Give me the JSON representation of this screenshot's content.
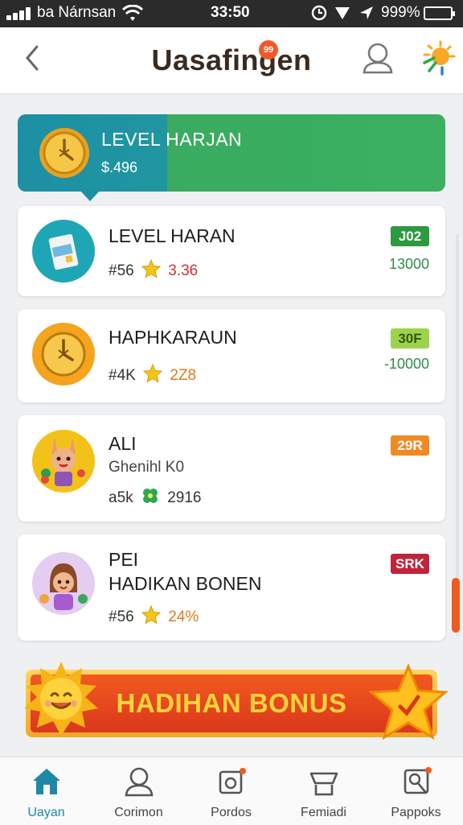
{
  "status_bar": {
    "carrier": "ba Nárnsan",
    "time": "33:50",
    "battery": "999%",
    "icons": [
      "signal-icon",
      "wifi-icon",
      "alarm-icon",
      "location-icon",
      "battery-icon"
    ]
  },
  "header": {
    "title": "Uasafingen",
    "notification_badge": "99",
    "icons": [
      "back-icon",
      "profile-icon",
      "sun-icon"
    ]
  },
  "level_banner": {
    "title": "LEVEL HARJAN",
    "subtitle": "$.496"
  },
  "cards": [
    {
      "name": "LEVEL HARAN",
      "count": "#56",
      "score": "3.36",
      "badge": "J02",
      "reward": "13000",
      "icon": "milk-carton-icon"
    },
    {
      "name": "HAPHKARAUN",
      "count": "#4K",
      "score": "2Z8",
      "badge": "30F",
      "reward": "-10000",
      "icon": "clock-coin-icon"
    },
    {
      "name": "ALI",
      "line2": "Ghenihl K0",
      "count": "a5k",
      "score": "2916",
      "badge": "29R",
      "icon": "rabbit-character-icon"
    },
    {
      "name": "PEI",
      "line2": "HADIKAN BONEN",
      "count": "#56",
      "score": "24%",
      "badge": "SRK",
      "icon": "girl-character-icon"
    }
  ],
  "bonus": {
    "label": "HADIHAN BONUS"
  },
  "bottom_nav": [
    {
      "label": "Uayan",
      "icon": "home-icon",
      "active": true
    },
    {
      "label": "Corimon",
      "icon": "profile-icon",
      "active": false
    },
    {
      "label": "Pordos",
      "icon": "card-icon",
      "active": false
    },
    {
      "label": "Femiadi",
      "icon": "basket-icon",
      "active": false
    },
    {
      "label": "Pappoks",
      "icon": "avatar-icon",
      "active": false
    }
  ],
  "colors": {
    "accent_teal": "#1d8fa5",
    "accent_green": "#3bb160",
    "bonus_orange": "#e4461f",
    "bonus_text": "#ffd43b",
    "scroll_thumb": "#f05a1e"
  }
}
